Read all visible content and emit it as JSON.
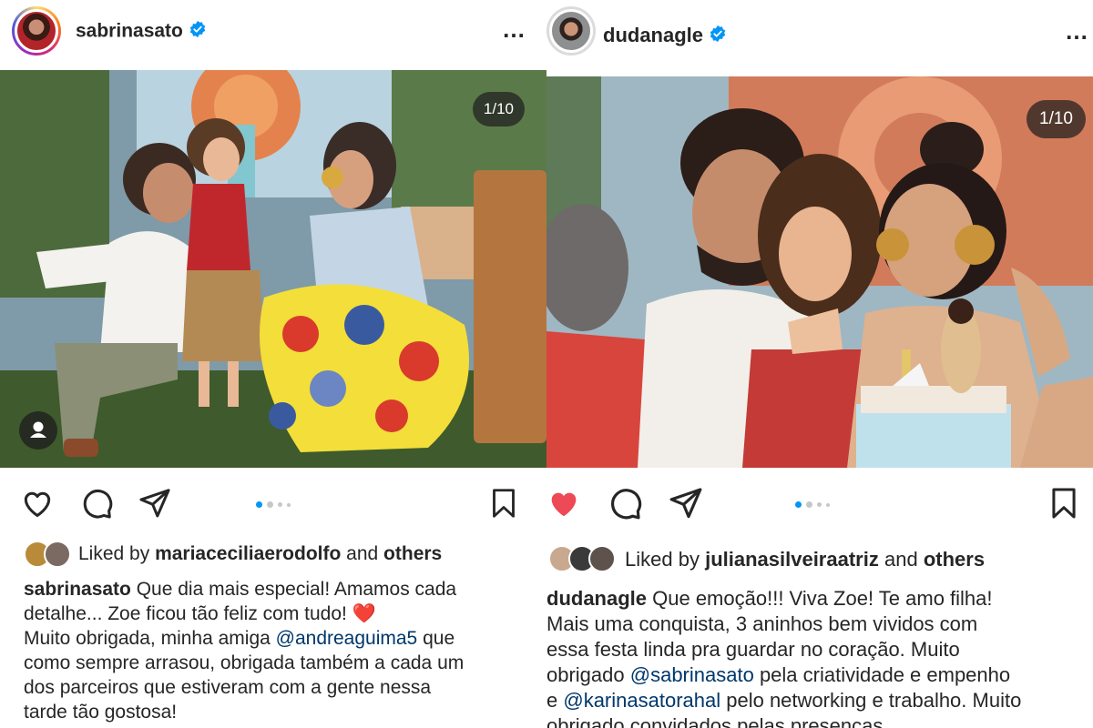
{
  "colors": {
    "accent_blue": "#0095f6",
    "mention_blue": "#00376b",
    "liked_red": "#ed4956",
    "text": "#262626"
  },
  "posts": [
    {
      "username": "sabrinasato",
      "verified": true,
      "more_icon": "…",
      "photo_counter": "1/10",
      "liked": false,
      "carousel_dots": 4,
      "likes": {
        "prefix": "Liked by",
        "user": "mariaceciliaerodolfo",
        "connector": "and",
        "others": "others"
      },
      "caption": {
        "author": "sabrinasato",
        "line1_text": " Que dia mais especial! Amamos cada",
        "line2_text": "detalhe... Zoe ficou tão feliz com tudo! ",
        "heart_emoji": "❤️",
        "line3_pre": "Muito obrigada, minha amiga ",
        "mention1": "@andreaguima5",
        "line3_post": " que",
        "line4_text": "como sempre arrasou, obrigada também a cada um",
        "line5_text": "dos parceiros que estiveram com a gente nessa",
        "line6_text": "tarde tão gostosa!"
      }
    },
    {
      "username": "dudanagle",
      "verified": true,
      "more_icon": "…",
      "photo_counter": "1/10",
      "liked": true,
      "carousel_dots": 4,
      "likes": {
        "prefix": "Liked by",
        "user": "julianasilveiraatriz",
        "connector": "and",
        "others": "others"
      },
      "caption": {
        "author": "dudanagle",
        "line1_text": " Que emoção!!! Viva Zoe! Te amo filha!",
        "line2_text": "Mais uma conquista, 3 aninhos bem vividos com",
        "line3_text": "essa festa linda pra guardar no coração. Muito",
        "line4_pre": "obrigado ",
        "mention1": "@sabrinasato",
        "line4_post": " pela criatividade e empenho",
        "line5_pre": "e ",
        "mention2": "@karinasatorahal",
        "line5_post": " pelo networking e trabalho. Muito",
        "line6_text": "obrigado convidados pelas presenças."
      }
    }
  ]
}
